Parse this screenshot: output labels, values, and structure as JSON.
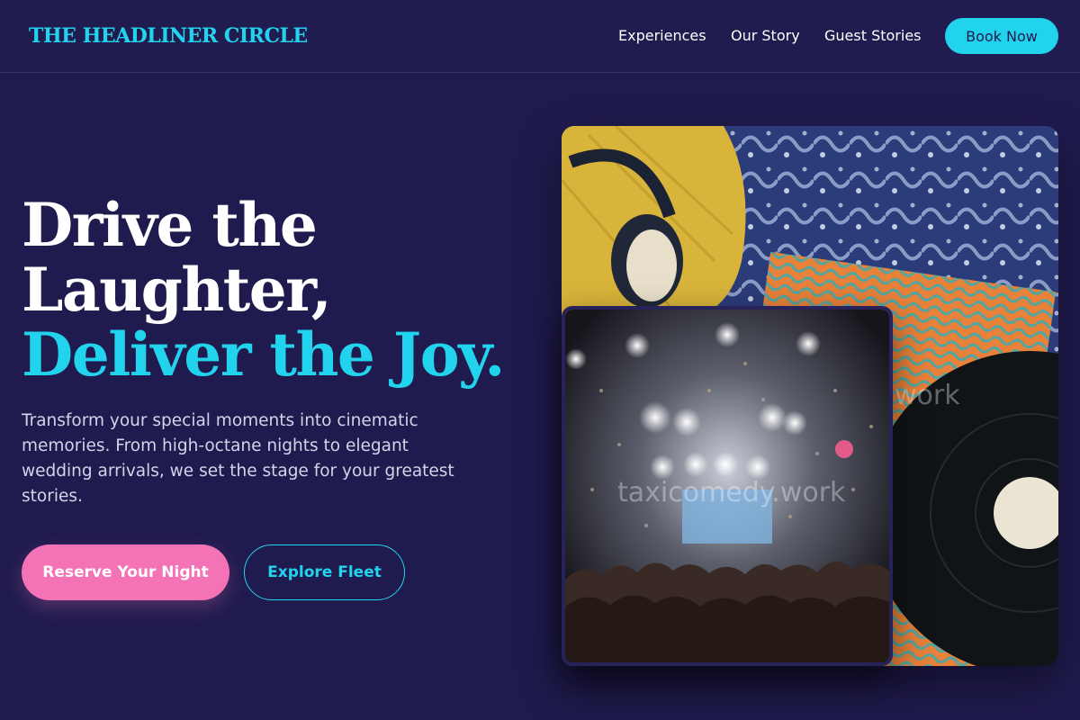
{
  "brand": {
    "name": "THE HEADLINER CIRCLE"
  },
  "nav": {
    "items": [
      "Experiences",
      "Our Story",
      "Guest Stories"
    ],
    "cta_label": "Book Now"
  },
  "hero": {
    "headline_line1": "Drive the",
    "headline_line2": "Laughter,",
    "headline_accent": "Deliver the Joy.",
    "description": "Transform your special moments into cinematic memories. From high-octane nights to elegant wedding arrivals, we set the stage for your greatest stories.",
    "primary_cta": "Reserve Your Night",
    "secondary_cta": "Explore Fleet"
  },
  "media": {
    "back_image": "headphones-and-vinyl-records-photo",
    "front_image": "concert-crowd-confetti-photo",
    "watermark_front": "taxicomedy.work",
    "watermark_back": "work"
  },
  "colors": {
    "background": "#201b4e",
    "accent_cyan": "#22d3ee",
    "accent_pink": "#f472b6"
  }
}
